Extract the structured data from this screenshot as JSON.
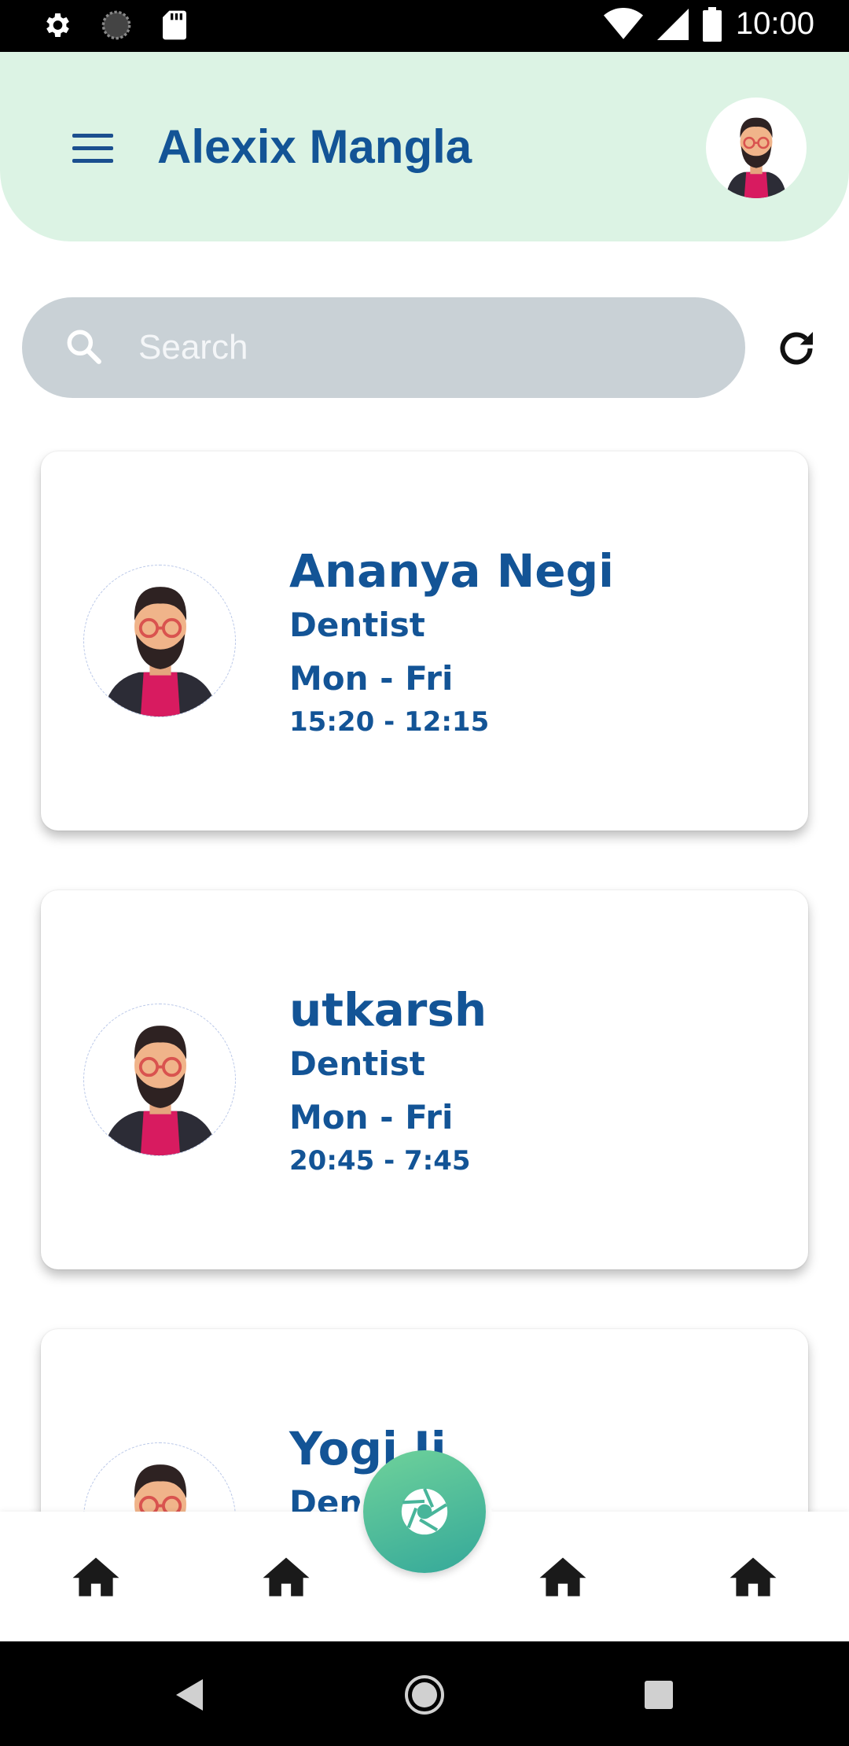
{
  "status_bar": {
    "time": "10:00",
    "icons": [
      "gear-icon",
      "loading-icon",
      "sd-card-icon",
      "wifi-icon",
      "signal-icon",
      "battery-icon"
    ]
  },
  "header": {
    "title": "Alexix Mangla",
    "menu_icon": "hamburger-menu-icon",
    "avatar_icon": "user-avatar",
    "background": "#dcf3e4",
    "title_color": "#135496"
  },
  "search": {
    "placeholder": "Search",
    "value": "",
    "icon": "search-icon",
    "refresh_icon": "refresh-icon"
  },
  "doctors": [
    {
      "name": "Ananya Negi",
      "specialty": "Dentist",
      "days": "Mon - Fri",
      "hours": "15:20 - 12:15"
    },
    {
      "name": "utkarsh",
      "specialty": "Dentist",
      "days": "Mon - Fri",
      "hours": "20:45 - 7:45"
    },
    {
      "name": "Yogi Ji",
      "specialty": "Dentist",
      "days": "",
      "hours": ""
    }
  ],
  "bottom_nav": {
    "items": [
      "home-icon",
      "home-icon",
      "home-icon",
      "home-icon"
    ],
    "fab_icon": "camera-shutter-icon",
    "fab_colors": [
      "#6fd29a",
      "#34a89a"
    ]
  },
  "system_nav": [
    "back-icon",
    "home-circle-icon",
    "recents-icon"
  ]
}
